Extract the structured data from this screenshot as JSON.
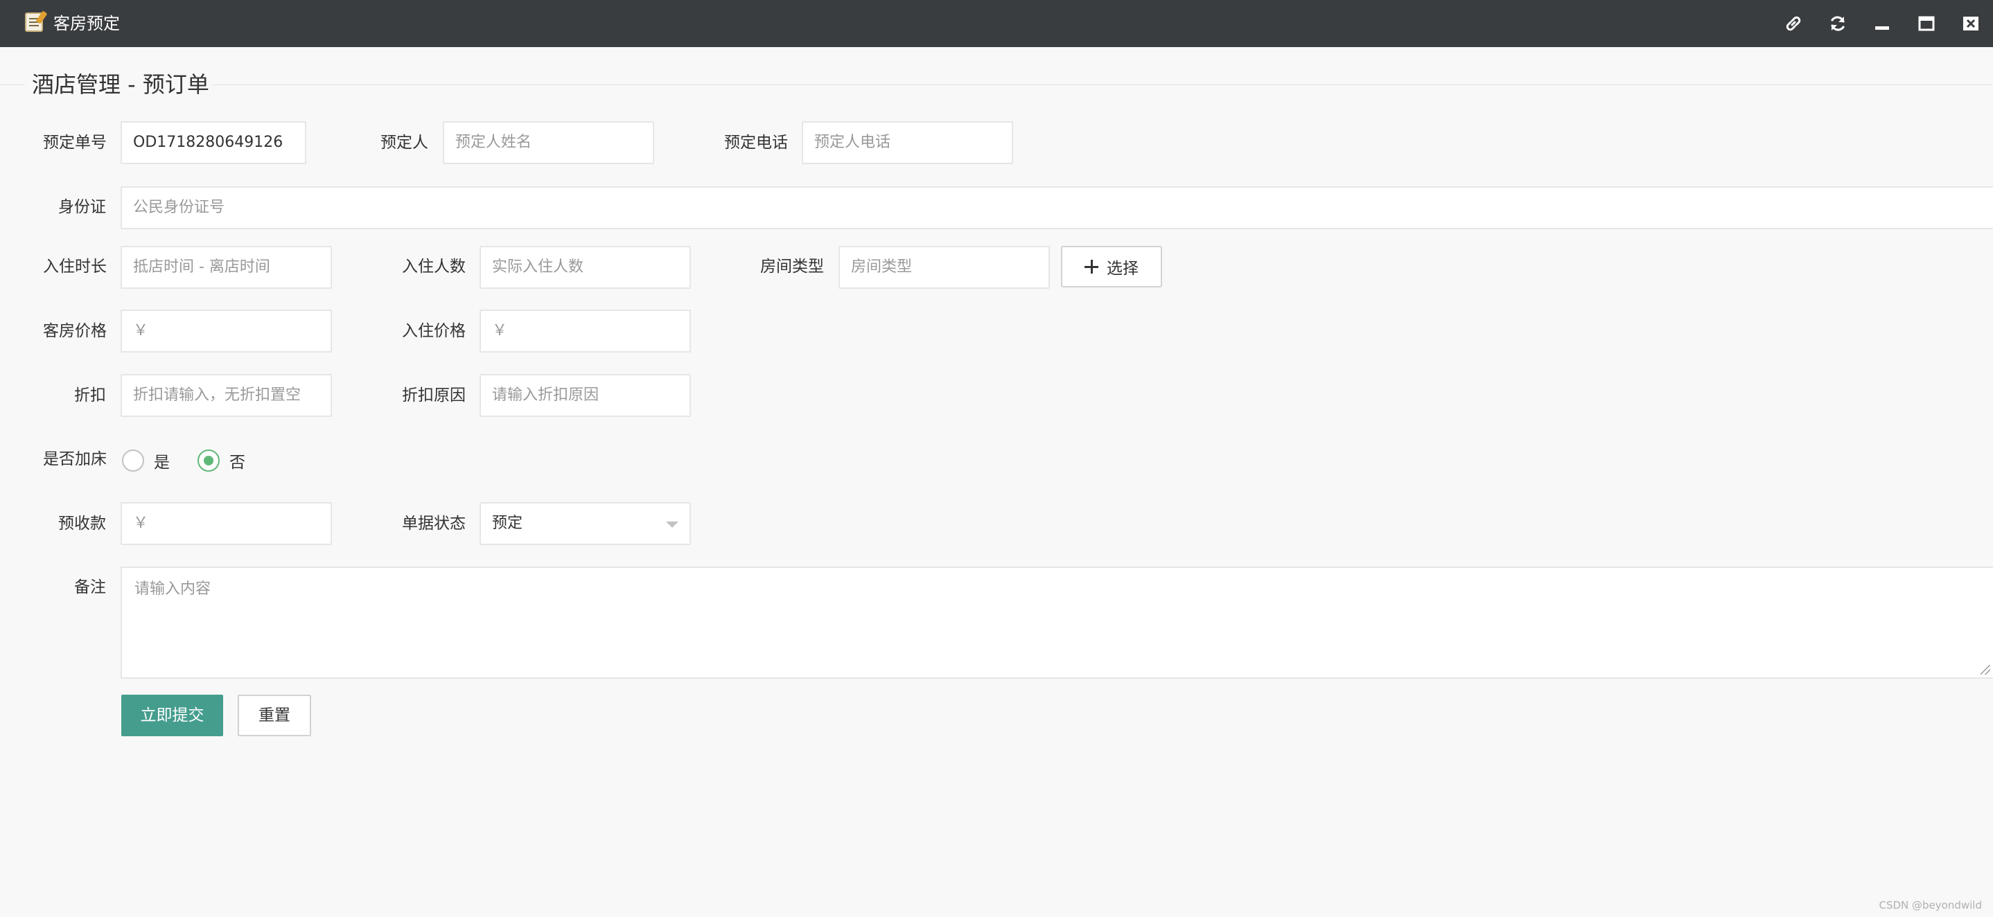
{
  "window": {
    "title": "客房预定"
  },
  "page": {
    "title": "酒店管理 - 预订单"
  },
  "form": {
    "order_no": {
      "label": "预定单号",
      "value": "OD1718280649126"
    },
    "booker": {
      "label": "预定人",
      "placeholder": "预定人姓名"
    },
    "phone": {
      "label": "预定电话",
      "placeholder": "预定人电话"
    },
    "id_card": {
      "label": "身份证",
      "placeholder": "公民身份证号"
    },
    "stay_duration": {
      "label": "入住时长",
      "placeholder": "抵店时间 - 离店时间"
    },
    "guest_count": {
      "label": "入住人数",
      "placeholder": "实际入住人数"
    },
    "room_type": {
      "label": "房间类型",
      "placeholder": "房间类型",
      "choose_label": "选择"
    },
    "room_price": {
      "label": "客房价格",
      "placeholder": "￥"
    },
    "stay_price": {
      "label": "入住价格",
      "placeholder": "￥"
    },
    "discount": {
      "label": "折扣",
      "placeholder": "折扣请输入，无折扣置空"
    },
    "discount_reason": {
      "label": "折扣原因",
      "placeholder": "请输入折扣原因"
    },
    "extra_bed": {
      "label": "是否加床",
      "options": [
        {
          "label": "是",
          "checked": false
        },
        {
          "label": "否",
          "checked": true
        }
      ]
    },
    "deposit": {
      "label": "预收款",
      "placeholder": "￥"
    },
    "status": {
      "label": "单据状态",
      "value": "预定"
    },
    "remark": {
      "label": "备注",
      "placeholder": "请输入内容"
    },
    "submit_label": "立即提交",
    "reset_label": "重置"
  },
  "colors": {
    "titlebar": "#393d40",
    "primary": "#459d8e",
    "radio_checked": "#5fb878"
  },
  "watermark": "CSDN @beyondwild"
}
